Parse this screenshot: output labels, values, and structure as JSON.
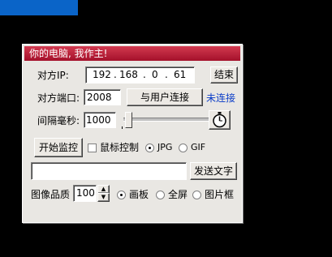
{
  "window": {
    "title": "你的电脑, 我作主!"
  },
  "ip": {
    "label": "对方IP:",
    "seg1": "192",
    "seg2": "168",
    "seg3": "0",
    "seg4": "61",
    "end_button": "结束"
  },
  "port": {
    "label": "对方端口:",
    "value": "2008",
    "connect_button": "与用户连接",
    "status": "未连接"
  },
  "interval": {
    "label": "间隔毫秒:",
    "value": "1000",
    "slider_fraction": 0.05
  },
  "monitor": {
    "start_button": "开始监控",
    "mouse_control_label": "鼠标控制",
    "jpg_label": "JPG",
    "gif_label": "GIF"
  },
  "message": {
    "value": "",
    "send_button": "发送文字"
  },
  "quality": {
    "label": "图像品质",
    "value": "100",
    "opt_canvas": "画板",
    "opt_fullscreen": "全屏",
    "opt_frame": "图片框"
  },
  "colors": {
    "title_bar": "#c0203a",
    "status_text": "#0a3cc8",
    "top_block": "#0a64c8"
  }
}
